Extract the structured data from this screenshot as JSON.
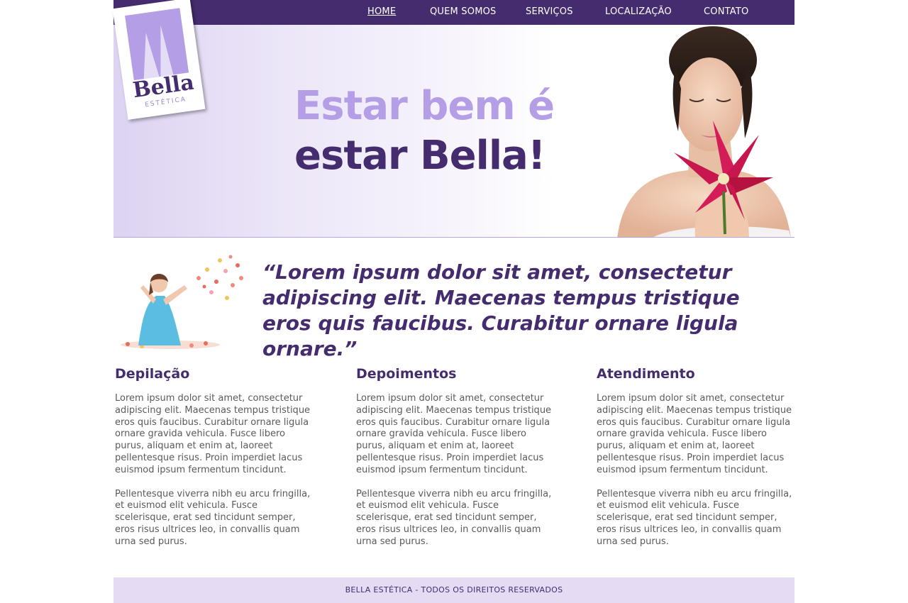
{
  "colors": {
    "brand_dark": "#442c6e",
    "brand_light": "#b49ee6",
    "footer_bg": "#e5dcf4",
    "body_text": "#5a5a5a"
  },
  "nav": {
    "items": [
      {
        "label": "HOME",
        "active": true
      },
      {
        "label": "QUEM SOMOS",
        "active": false
      },
      {
        "label": "SERVIÇOS",
        "active": false
      },
      {
        "label": "LOCALIZAÇÃO",
        "active": false
      },
      {
        "label": "CONTATO",
        "active": false
      }
    ]
  },
  "logo": {
    "name": "Bella",
    "tagline": "ESTÉTICA"
  },
  "hero": {
    "line1": "Estar bem é",
    "line2": "estar Bella!"
  },
  "quote": {
    "text": "“Lorem ipsum dolor sit amet, consectetur adipiscing elit. Maecenas tempus tristique eros quis faucibus. Curabitur ornare ligula ornare.”"
  },
  "columns": [
    {
      "title": "Depilação",
      "p1": "Lorem ipsum dolor sit amet, consectetur adipiscing elit. Maecenas tempus tristique eros quis faucibus. Curabitur ornare ligula ornare gravida vehicula. Fusce libero purus, aliquam et enim at, laoreet pellentesque risus. Proin imperdiet lacus euismod ipsum fermentum tincidunt.",
      "p2": "Pellentesque viverra nibh eu arcu fringilla, et euismod elit vehicula. Fusce scelerisque, erat sed tincidunt semper, eros risus ultrices leo, in convallis quam urna sed purus."
    },
    {
      "title": "Depoimentos",
      "p1": "Lorem ipsum dolor sit amet, consectetur adipiscing elit. Maecenas tempus tristique eros quis faucibus. Curabitur ornare ligula ornare gravida vehicula. Fusce libero purus, aliquam et enim at, laoreet pellentesque risus. Proin imperdiet lacus euismod ipsum fermentum tincidunt.",
      "p2": "Pellentesque viverra nibh eu arcu fringilla, et euismod elit vehicula. Fusce scelerisque, erat sed tincidunt semper, eros risus ultrices leo, in convallis quam urna sed purus."
    },
    {
      "title": "Atendimento",
      "p1": "Lorem ipsum dolor sit amet, consectetur adipiscing elit. Maecenas tempus tristique eros quis faucibus. Curabitur ornare ligula ornare gravida vehicula. Fusce libero purus, aliquam et enim at, laoreet pellentesque risus. Proin imperdiet lacus euismod ipsum fermentum tincidunt.",
      "p2": "Pellentesque viverra nibh eu arcu fringilla, et euismod elit vehicula. Fusce scelerisque, erat sed tincidunt semper, eros risus ultrices leo, in convallis quam urna sed purus."
    }
  ],
  "footer": {
    "text": "BELLA ESTÉTICA - TODOS OS DIREITOS RESERVADOS"
  }
}
